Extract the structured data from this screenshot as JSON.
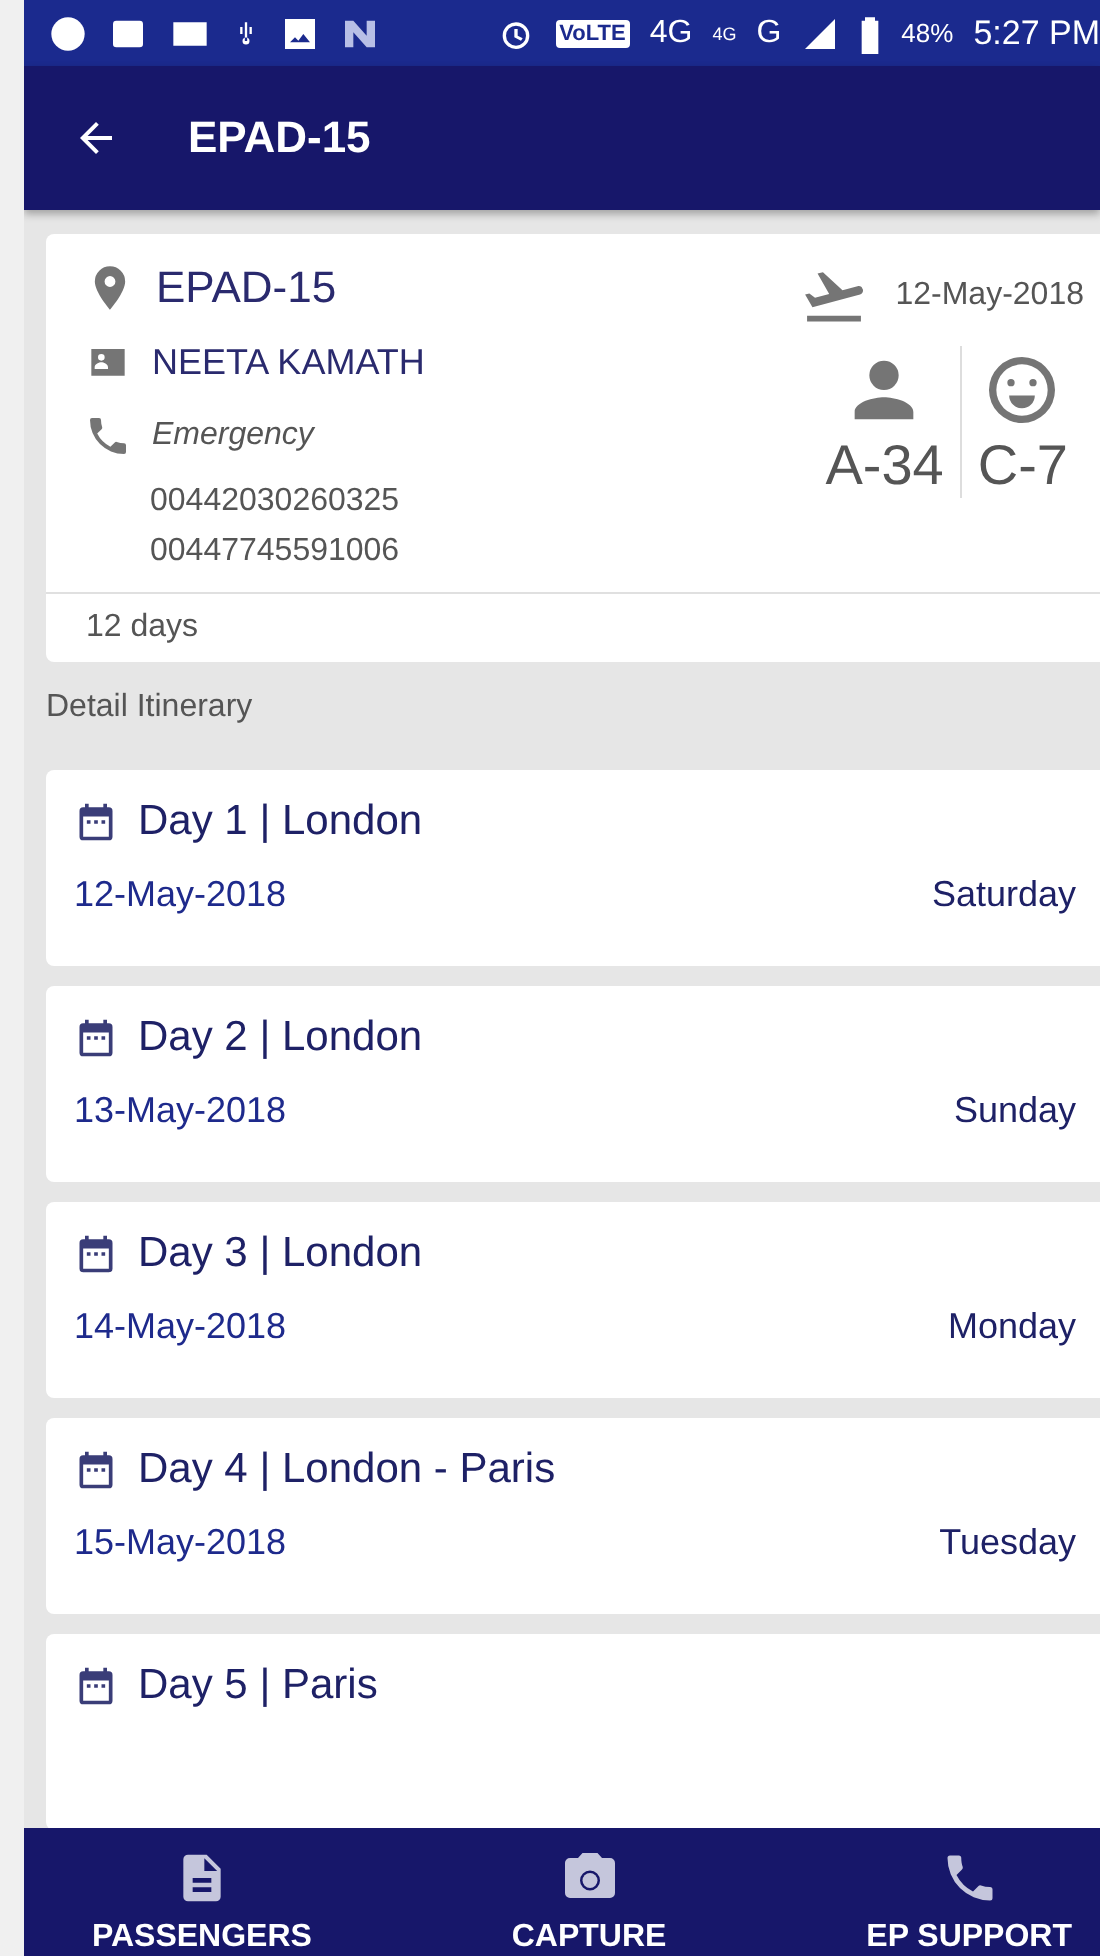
{
  "status_bar": {
    "network_texts": [
      "VoLTE",
      "4G",
      "4G",
      "G"
    ],
    "battery": "48%",
    "time": "5:27 PM"
  },
  "app_bar": {
    "title": "EPAD-15"
  },
  "summary": {
    "code": "EPAD-15",
    "departure_date": "12-May-2018",
    "leader": "NEETA KAMATH",
    "emergency_label": "Emergency",
    "phones": [
      "00442030260325",
      "00447745591006"
    ],
    "adults": "A-34",
    "children": "C-7",
    "duration": "12 days"
  },
  "section_title": "Detail Itinerary",
  "days": [
    {
      "title": "Day 1 | London",
      "date": "12-May-2018",
      "weekday": "Saturday"
    },
    {
      "title": "Day 2 |  London",
      "date": "13-May-2018",
      "weekday": "Sunday"
    },
    {
      "title": "Day 3 | London",
      "date": "14-May-2018",
      "weekday": "Monday"
    },
    {
      "title": "Day 4 | London - Paris",
      "date": "15-May-2018",
      "weekday": "Tuesday"
    },
    {
      "title": "Day 5 | Paris"
    }
  ],
  "bottom_nav": [
    {
      "label": "PASSENGERS",
      "kind": "document"
    },
    {
      "label": "CAPTURE",
      "kind": "camera"
    },
    {
      "label": "EP SUPPORT",
      "kind": "phone"
    }
  ]
}
